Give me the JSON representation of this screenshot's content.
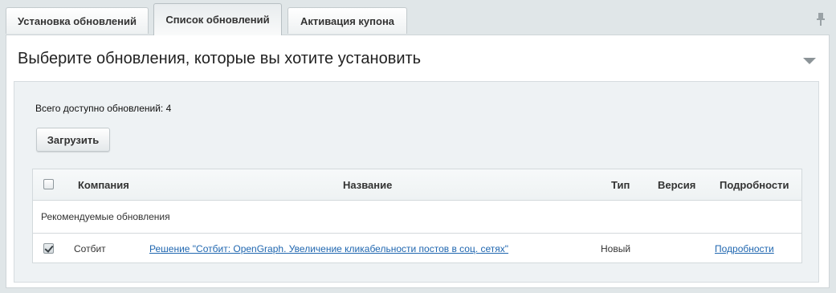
{
  "tabs": [
    {
      "label": "Установка обновлений",
      "active": false
    },
    {
      "label": "Список обновлений",
      "active": true
    },
    {
      "label": "Активация купона",
      "active": false
    }
  ],
  "panel": {
    "title": "Выберите обновления, которые вы хотите установить",
    "total": "Всего доступно обновлений: 4",
    "load_button": "Загрузить"
  },
  "table": {
    "headers": {
      "company": "Компания",
      "name": "Название",
      "type": "Тип",
      "version": "Версия",
      "details": "Подробности"
    },
    "group_label": "Рекомендуемые обновления",
    "rows": [
      {
        "checked": true,
        "company": "Сотбит",
        "name": "Решение \"Сотбит: OpenGraph. Увеличение кликабельности постов в соц. сетях\"",
        "type": "Новый",
        "version": "",
        "details": "Подробности"
      }
    ]
  },
  "colors": {
    "background": "#e0e6e8",
    "link": "#2067b0",
    "panel": "#ffffff"
  },
  "icons": {
    "pin": "pin-icon",
    "collapse": "chevron-down-icon"
  }
}
